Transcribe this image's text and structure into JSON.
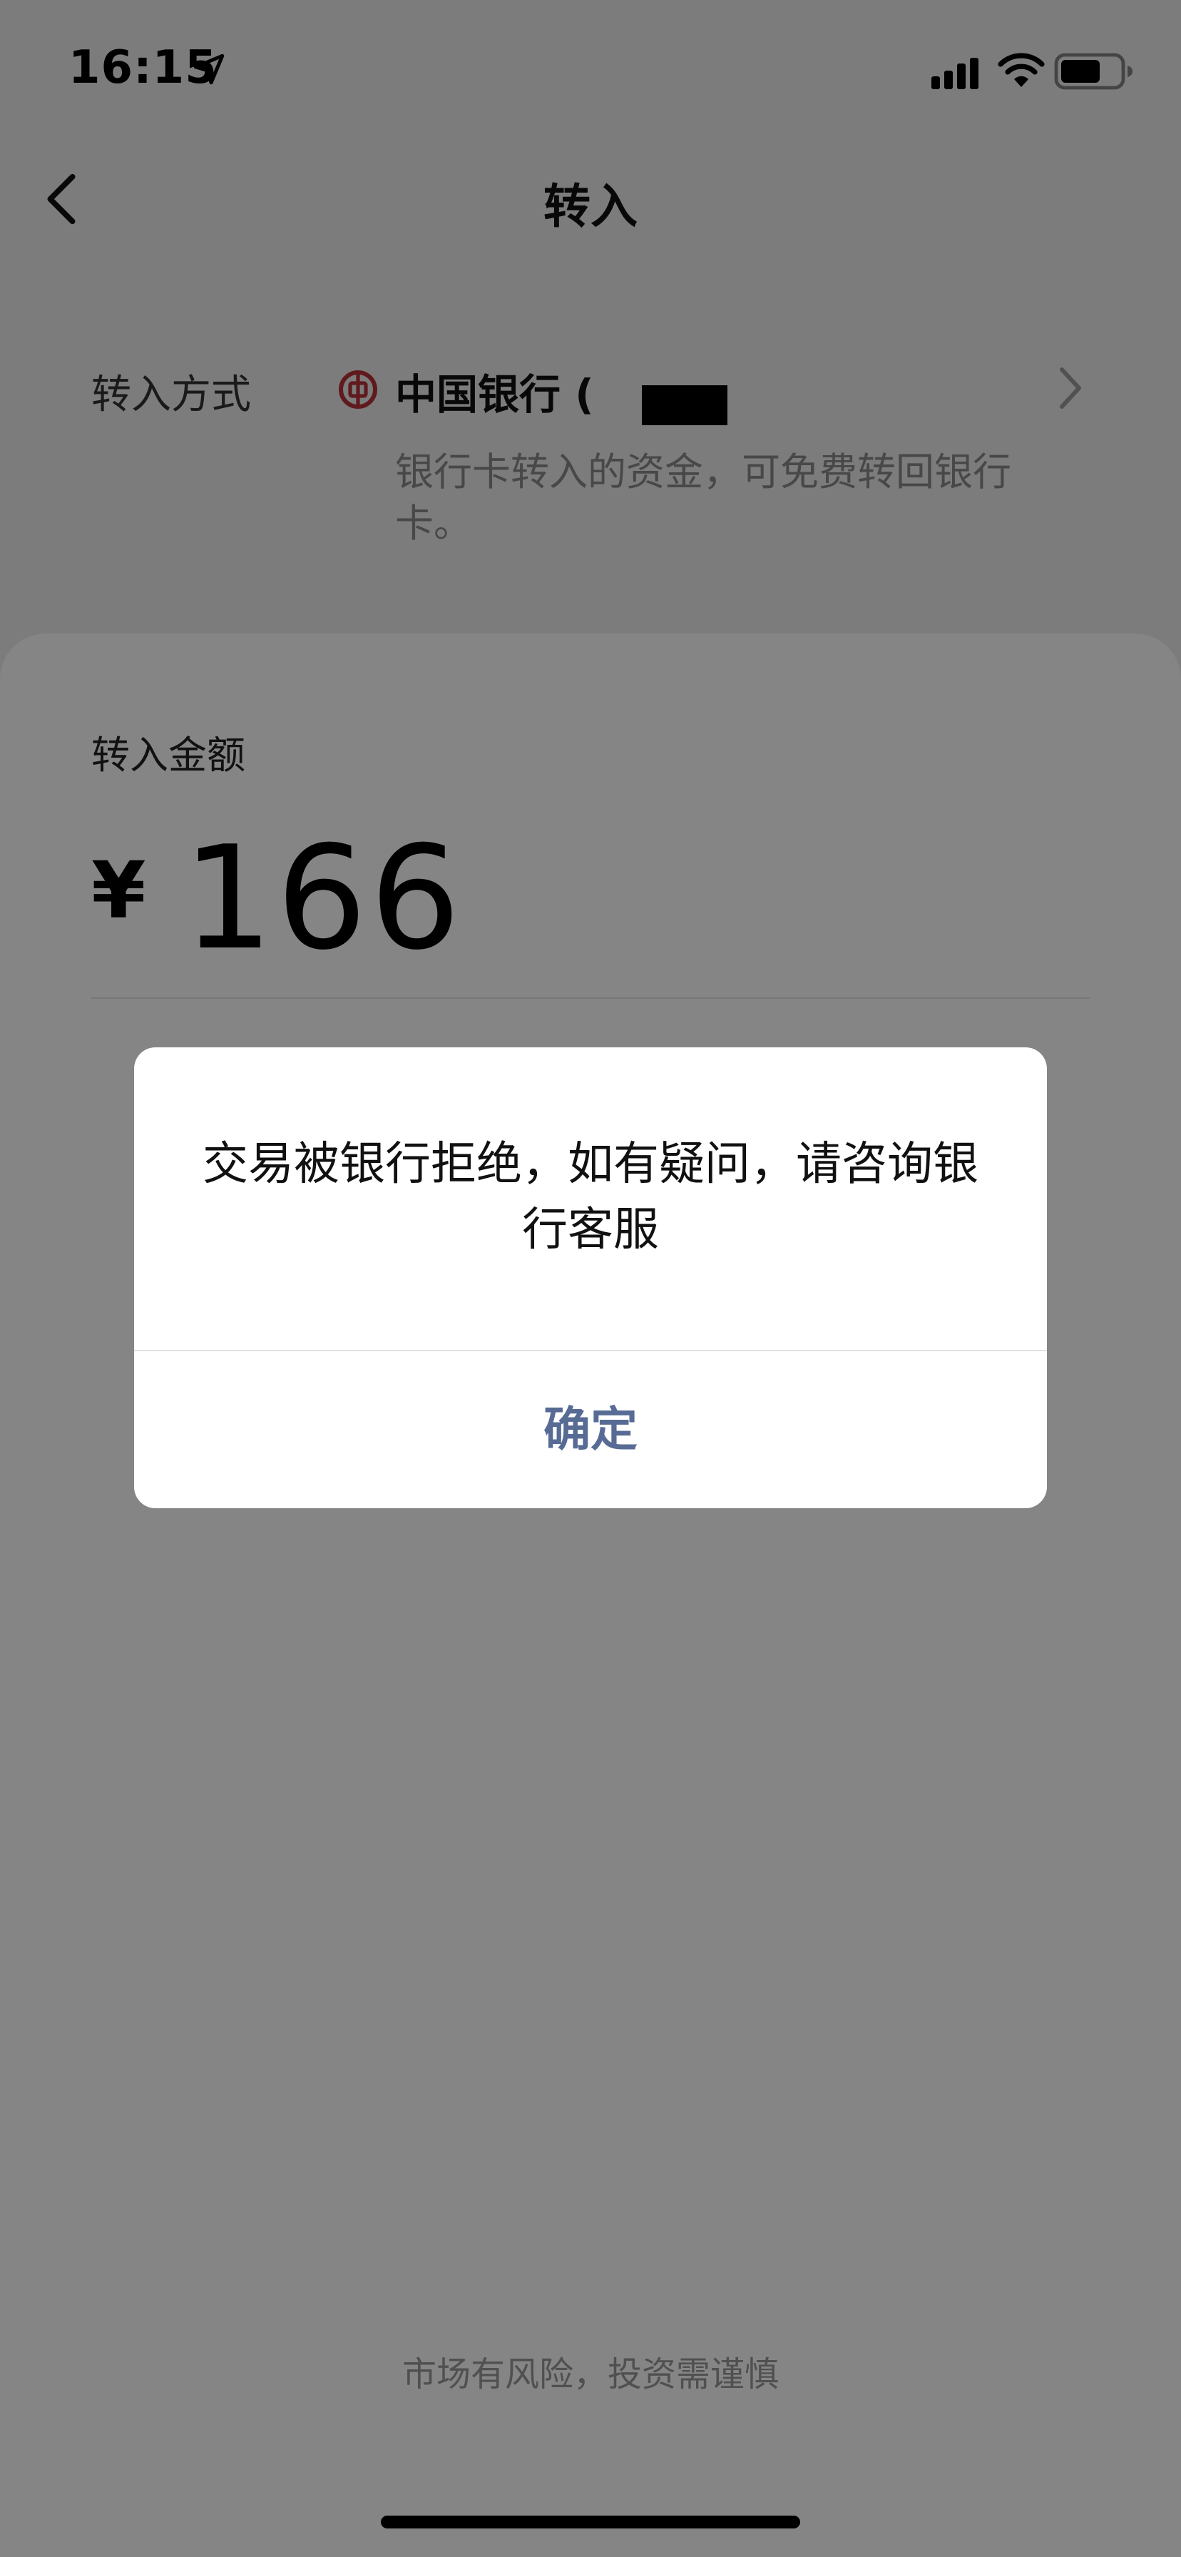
{
  "status_bar": {
    "time": "16:15",
    "icons": [
      "location-arrow-icon",
      "signal-icon",
      "wifi-icon",
      "battery-icon"
    ]
  },
  "nav": {
    "title": "转入",
    "back_icon": "chevron-left-icon"
  },
  "transfer_method": {
    "label": "转入方式",
    "bank_name": "中国银行 (",
    "description": "银行卡转入的资金，可免费转回银行卡。",
    "bank_icon": "bank-of-china-logo-icon",
    "arrow_icon": "chevron-right-icon"
  },
  "amount": {
    "label": "转入金额",
    "currency": "¥",
    "value": "166"
  },
  "dialog": {
    "message": "交易被银行拒绝，如有疑问，请咨询银行客服",
    "confirm_label": "确定"
  },
  "footer": {
    "disclaimer": "市场有风险，投资需谨慎"
  },
  "colors": {
    "link_blue": "#576b95",
    "bank_red": "#b8323a",
    "background": "#ededed",
    "overlay": "rgba(0,0,0,0.48)"
  }
}
